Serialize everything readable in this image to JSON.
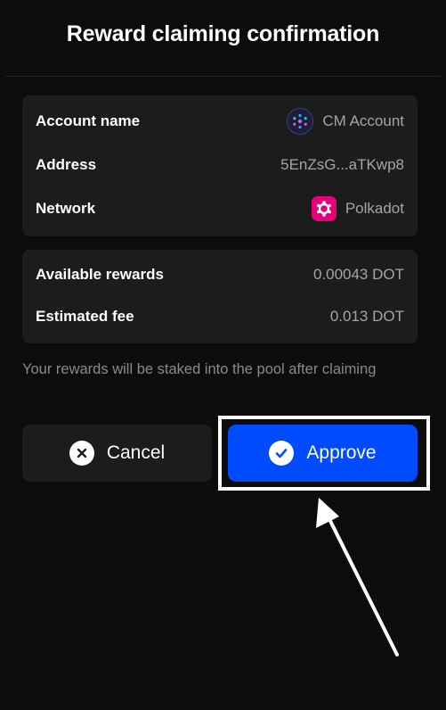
{
  "dialog": {
    "title": "Reward claiming confirmation"
  },
  "details": {
    "account_label": "Account name",
    "account_value": "CM Account",
    "address_label": "Address",
    "address_value": "5EnZsG...aTKwp8",
    "network_label": "Network",
    "network_value": "Polkadot"
  },
  "rewards": {
    "available_label": "Available rewards",
    "available_value": "0.00043 DOT",
    "fee_label": "Estimated fee",
    "fee_value": "0.013 DOT"
  },
  "note": "Your rewards will be staked into the pool after claiming",
  "actions": {
    "cancel_label": "Cancel",
    "approve_label": "Approve"
  },
  "icons": {
    "account": "cm-account-icon",
    "network": "polkadot-icon",
    "cancel": "close-circle-icon",
    "approve": "check-circle-icon"
  },
  "colors": {
    "background": "#0c0c0c",
    "card": "#1c1c1c",
    "approve": "#004bff",
    "polkadot": "#e6007a",
    "muted_text": "#a5a5a5"
  }
}
